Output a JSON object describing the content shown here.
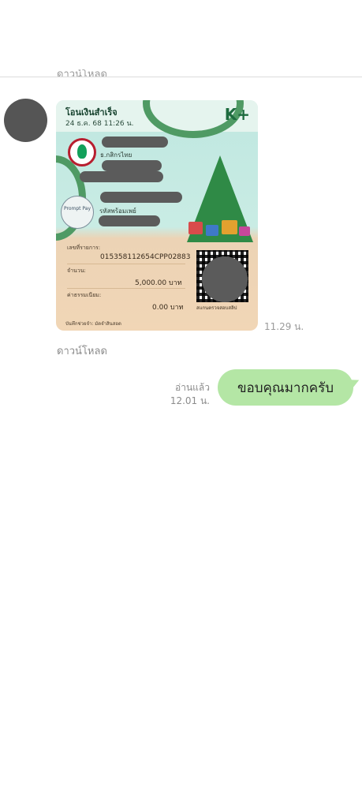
{
  "chat": {
    "cut_download_label": "ดาวน์โหลด",
    "incoming_time": "11.29 น.",
    "download_label": "ดาวน์โหลด",
    "outgoing": {
      "read_label": "อ่านแล้ว",
      "time": "12.01 น.",
      "message": "ขอบคุณมากครับ"
    }
  },
  "slip": {
    "title": "โอนเงินสำเร็จ",
    "date": "24 ธ.ค. 68  11:26 น.",
    "brand": "K+",
    "bank_name": "ธ.กสิกรไทย",
    "promptpay_logo": "Prompt Pay",
    "promptpay_name": "รหัสพร้อมเพย์",
    "ref_label": "เลขที่รายการ:",
    "ref_value": "015358112654CPP02883",
    "amount_label": "จำนวน:",
    "amount_value": "5,000.00 บาท",
    "fee_label": "ค่าธรรมเนียม:",
    "fee_value": "0.00 บาท",
    "qr_caption": "สแกนตรวจสอบสลิป",
    "memo": "บันทึกช่วยจำ: มัดจำสินสอด"
  }
}
